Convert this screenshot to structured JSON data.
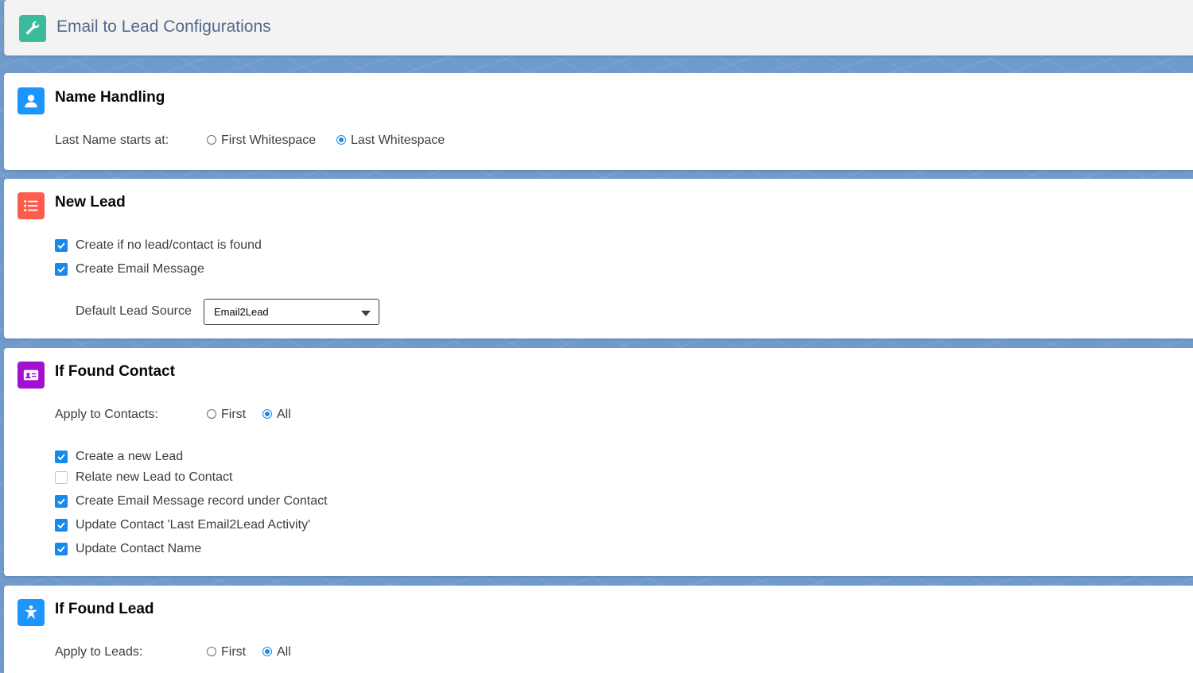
{
  "header": {
    "title": "Email to Lead Configurations",
    "icon": "wrench-icon",
    "icon_color": "#3bba9c"
  },
  "name_handling": {
    "title": "Name Handling",
    "icon": "user-icon",
    "icon_color": "#1b96ff",
    "label": "Last Name starts at:",
    "options": [
      {
        "label": "First Whitespace",
        "selected": false
      },
      {
        "label": "Last Whitespace",
        "selected": true
      }
    ]
  },
  "new_lead": {
    "title": "New Lead",
    "icon": "list-icon",
    "icon_color": "#fe5c4c",
    "checkboxes": [
      {
        "label": "Create if no lead/contact is found",
        "checked": true
      },
      {
        "label": "Create Email Message",
        "checked": true
      }
    ],
    "lead_source_label": "Default Lead Source",
    "lead_source_value": "Email2Lead"
  },
  "found_contact": {
    "title": "If Found Contact",
    "icon": "contact-card-icon",
    "icon_color": "#a20fce",
    "label": "Apply to Contacts:",
    "options": [
      {
        "label": "First",
        "selected": false
      },
      {
        "label": "All",
        "selected": true
      }
    ],
    "checkboxes": [
      {
        "label": "Create a new Lead",
        "checked": true
      },
      {
        "label": "Relate new Lead to Contact",
        "checked": false
      },
      {
        "label": "Create Email Message record under Contact",
        "checked": true
      },
      {
        "label": "Update Contact 'Last Email2Lead Activity'",
        "checked": true
      },
      {
        "label": "Update Contact Name",
        "checked": true
      }
    ]
  },
  "found_lead": {
    "title": "If Found Lead",
    "icon": "lead-star-icon",
    "icon_color": "#1b96ff",
    "label": "Apply to Leads:",
    "options": [
      {
        "label": "First",
        "selected": false
      },
      {
        "label": "All",
        "selected": true
      }
    ]
  },
  "colors": {
    "accent": "#1589ee",
    "background": "#6f9bcc"
  }
}
